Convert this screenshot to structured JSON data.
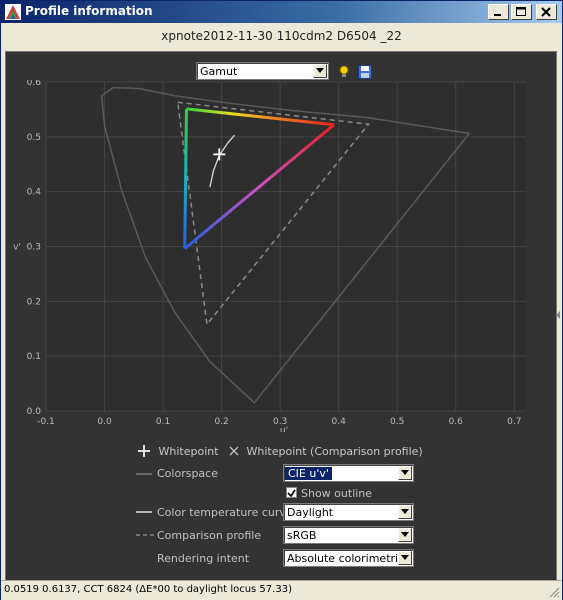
{
  "window": {
    "title": "Profile information"
  },
  "profile_name": "xpnote2012-11-30 110cdm2 D6504 _22",
  "view_select": {
    "value": "Gamut"
  },
  "legend": {
    "whitepoint": "Whitepoint",
    "whitepoint_comparison": "Whitepoint (Comparison profile)",
    "colorspace_label": "Colorspace",
    "colorspace_value": "CIE u'v'",
    "show_outline": "Show outline",
    "color_temp_label": "Color temperature curve",
    "color_temp_value": "Daylight",
    "comparison_label": "Comparison profile",
    "comparison_value": "sRGB",
    "intent_label": "Rendering intent",
    "intent_value": "Absolute colorimetric"
  },
  "status": "0.0519 0.6137, CCT 6824 (ΔE*00 to daylight locus 57.33)",
  "chart_data": {
    "type": "scatter",
    "xlabel": "u'",
    "ylabel": "v'",
    "xlim": [
      -0.1,
      0.72
    ],
    "ylim": [
      0.0,
      0.6
    ],
    "xticks": [
      "-0.1",
      "0.0",
      "0.1",
      "0.2",
      "0.3",
      "0.4",
      "0.5",
      "0.6",
      "0.7"
    ],
    "yticks": [
      "0.0",
      "0.1",
      "0.2",
      "0.3",
      "0.4",
      "0.5",
      "0.6"
    ],
    "grid": true,
    "series": [
      {
        "name": "profile gamut",
        "points": [
          [
            0.14,
            0.551
          ],
          [
            0.392,
            0.522
          ],
          [
            0.137,
            0.296
          ],
          [
            0.14,
            0.551
          ]
        ]
      },
      {
        "name": "comparison profile",
        "points": [
          [
            0.125,
            0.563
          ],
          [
            0.451,
            0.523
          ],
          [
            0.175,
            0.158
          ],
          [
            0.125,
            0.563
          ]
        ]
      },
      {
        "name": "whitepoint",
        "points": [
          [
            0.196,
            0.468
          ]
        ]
      },
      {
        "name": "color temperature curve",
        "points": [
          [
            0.18,
            0.408
          ],
          [
            0.186,
            0.438
          ],
          [
            0.196,
            0.466
          ],
          [
            0.21,
            0.488
          ],
          [
            0.222,
            0.503
          ]
        ]
      },
      {
        "name": "spectral locus",
        "points": [
          [
            0.256,
            0.015
          ],
          [
            0.18,
            0.09
          ],
          [
            0.12,
            0.18
          ],
          [
            0.07,
            0.28
          ],
          [
            0.03,
            0.4
          ],
          [
            0.0,
            0.52
          ],
          [
            -0.005,
            0.575
          ],
          [
            0.015,
            0.59
          ],
          [
            0.06,
            0.588
          ],
          [
            0.12,
            0.575
          ],
          [
            0.2,
            0.563
          ],
          [
            0.32,
            0.548
          ],
          [
            0.45,
            0.535
          ],
          [
            0.623,
            0.506
          ],
          [
            0.256,
            0.015
          ]
        ]
      }
    ]
  }
}
